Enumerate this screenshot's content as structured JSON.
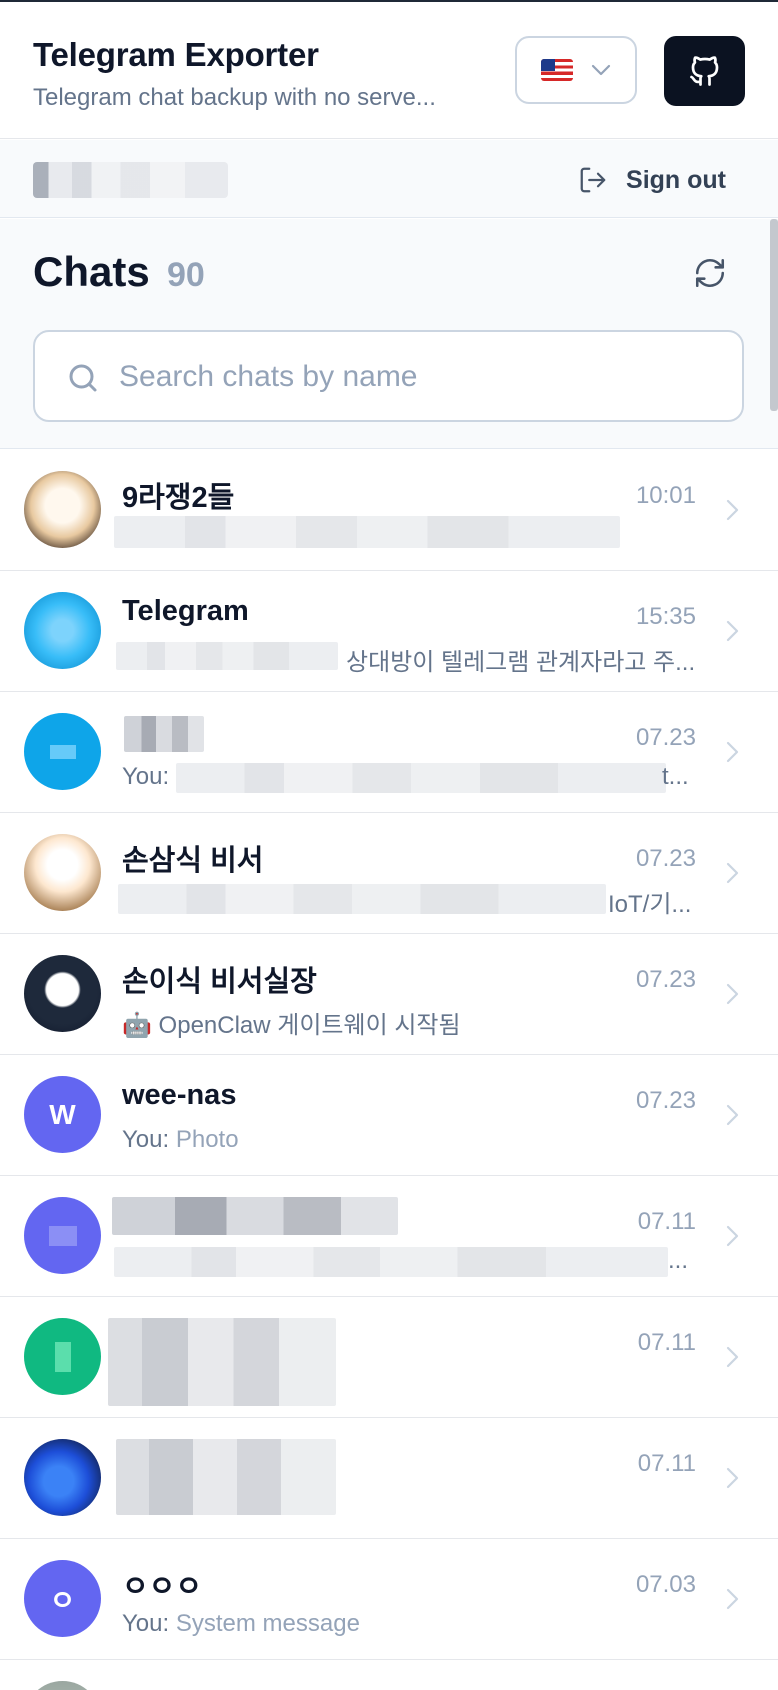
{
  "header": {
    "title": "Telegram Exporter",
    "subtitle": "Telegram chat backup with no serve...",
    "language": "flag-us-icon",
    "github_icon": "github-icon"
  },
  "account": {
    "sign_out_label": "Sign out"
  },
  "chats": {
    "title": "Chats",
    "count": "90",
    "search_placeholder": "Search chats by name",
    "items": [
      {
        "name": "9라쟁2들",
        "time": "10:01",
        "prefix": "",
        "preview": "",
        "avatar_color": "#f5e6d3"
      },
      {
        "name": "Telegram",
        "time": "15:35",
        "prefix": "",
        "preview": "상대방이 텔레그램 관계자라고 주...",
        "avatar_color": "#38bdf8"
      },
      {
        "name": "",
        "time": "07.23",
        "prefix": "You:",
        "preview": "",
        "preview_tail": "t...",
        "avatar_color": "#0ea5e9"
      },
      {
        "name": "손삼식 비서",
        "time": "07.23",
        "prefix": "",
        "preview": "",
        "preview_tail": "IoT/기...",
        "avatar_color": "#fde7cf"
      },
      {
        "name": "손이식 비서실장",
        "time": "07.23",
        "prefix": "",
        "preview": "🤖 OpenClaw 게이트웨이 시작됨",
        "avatar_color": "#0f172a"
      },
      {
        "name": "wee-nas",
        "time": "07.23",
        "prefix": "You:",
        "preview": "Photo",
        "avatar_letter": "W",
        "avatar_color": "#6366f1"
      },
      {
        "name": "",
        "time": "07.11",
        "prefix": "",
        "preview": "",
        "preview_tail": "...",
        "avatar_color": "#6366f1"
      },
      {
        "name": "",
        "time": "07.11",
        "prefix": "",
        "preview": "",
        "avatar_color": "#10b981"
      },
      {
        "name": "",
        "time": "07.11",
        "prefix": "",
        "preview": "",
        "avatar_color": "#1d4ed8"
      },
      {
        "name": "ㅇㅇㅇ",
        "time": "07.03",
        "prefix": "You:",
        "preview": "System message",
        "avatar_letter": "ㅇ",
        "avatar_color": "#6366f1"
      }
    ]
  }
}
